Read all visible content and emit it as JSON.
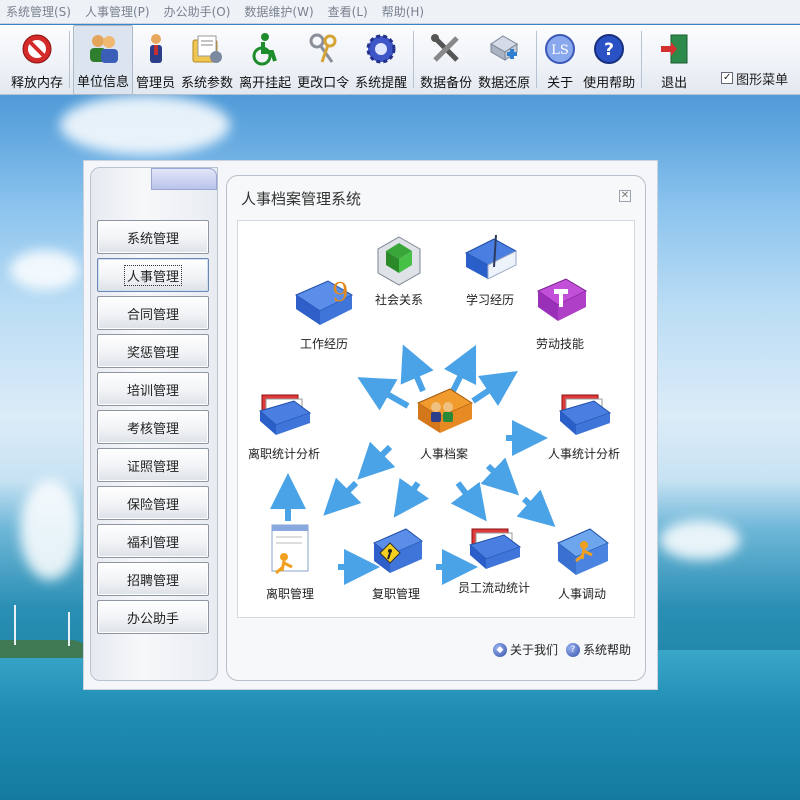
{
  "menubar": {
    "items": [
      "系统管理(S)",
      "人事管理(P)",
      "办公助手(O)",
      "数据维护(W)",
      "查看(L)",
      "帮助(H)"
    ]
  },
  "toolbar": {
    "buttons": [
      {
        "label": "释放内存",
        "icon": "no-entry-icon"
      },
      {
        "label": "单位信息",
        "icon": "users-icon"
      },
      {
        "label": "管理员",
        "icon": "admin-person-icon"
      },
      {
        "label": "系统参数",
        "icon": "settings-folder-icon"
      },
      {
        "label": "离开挂起",
        "icon": "wheelchair-icon"
      },
      {
        "label": "更改口令",
        "icon": "keys-icon"
      },
      {
        "label": "系统提醒",
        "icon": "gear-icon"
      },
      {
        "label": "数据备份",
        "icon": "tools-icon"
      },
      {
        "label": "数据还原",
        "icon": "restore-icon"
      },
      {
        "label": "关于",
        "icon": "logo-icon"
      },
      {
        "label": "使用帮助",
        "icon": "help-icon"
      },
      {
        "label": "退出",
        "icon": "exit-door-icon"
      }
    ],
    "graphic_menu_label": "图形菜单",
    "graphic_menu_checked": true
  },
  "sidebar": {
    "items": [
      "系统管理",
      "人事管理",
      "合同管理",
      "奖惩管理",
      "培训管理",
      "考核管理",
      "证照管理",
      "保险管理",
      "福利管理",
      "招聘管理",
      "办公助手"
    ],
    "active_index": 1
  },
  "content": {
    "title": "人事档案管理系统",
    "nodes": {
      "work_history": "工作经历",
      "social_relations": "社会关系",
      "study_history": "学习经历",
      "labor_skills": "劳动技能",
      "resign_stats": "离职统计分析",
      "personnel_file": "人事档案",
      "personnel_stats": "人事统计分析",
      "resign_mgmt": "离职管理",
      "rehire_mgmt": "复职管理",
      "staff_flow_stats": "员工流动统计",
      "transfer": "人事调动"
    },
    "footer": {
      "about": "关于我们",
      "help": "系统帮助"
    }
  },
  "colors": {
    "arrow": "#4aa3e6",
    "accent": "#6b89b4"
  }
}
